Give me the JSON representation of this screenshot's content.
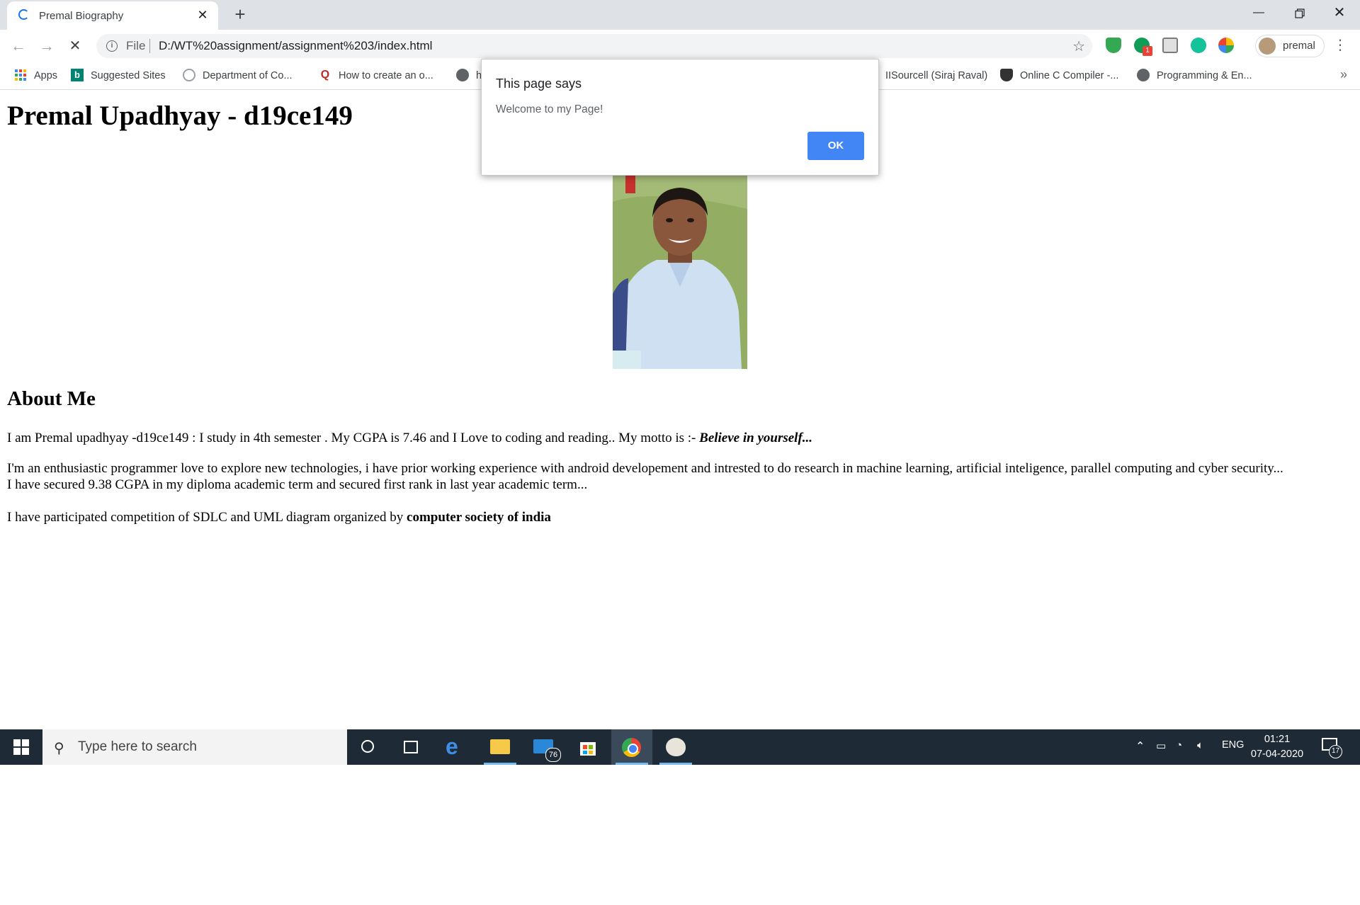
{
  "browser": {
    "tab_title": "Premal Biography",
    "url_scheme": "File",
    "url": "D:/WT%20assignment/assignment%203/index.html",
    "profile_name": "premal"
  },
  "bookmarks": [
    {
      "label": "Apps",
      "icon": "apps-grid-icon"
    },
    {
      "label": "Suggested Sites",
      "icon": "bing-icon"
    },
    {
      "label": "Department of Co...",
      "icon": "globe-icon"
    },
    {
      "label": "How to create an o...",
      "icon": "quora-icon"
    },
    {
      "label": "h",
      "icon": "globe-icon"
    },
    {
      "label": "IISourcell (Siraj Raval)",
      "icon": "youtube-icon"
    },
    {
      "label": "Online C Compiler -...",
      "icon": "compiler-icon"
    },
    {
      "label": "Programming & En...",
      "icon": "globe-icon"
    }
  ],
  "page": {
    "heading": "Premal Upadhyay - d19ce149",
    "about_heading": "About Me",
    "para1_text": "I am Premal upadhyay -d19ce149 : I study in 4th semester . My CGPA is 7.46 and I Love to coding and reading.. My motto is :- ",
    "para1_motto": "Believe in yourself...",
    "para2_line1": "I'm an enthusiastic programmer love to explore new technologies, i have prior working experience with android developement and intrested to do research in machine learning, artificial inteligence, parallel computing and cyber security...",
    "para2_line2": "I have secured 9.38 CGPA in my diploma academic term and secured first rank in last year academic term...",
    "para3_text": "I have participated competition of SDLC and UML diagram organized by ",
    "para3_bold": "computer society of india"
  },
  "dialog": {
    "title": "This page says",
    "message": "Welcome to my Page!",
    "ok_label": "OK"
  },
  "taskbar": {
    "search_placeholder": "Type here to search",
    "mail_badge": "76",
    "language": "ENG",
    "time": "01:21",
    "date": "07-04-2020",
    "notification_count": "17"
  },
  "extensions": {
    "badge": "1"
  }
}
